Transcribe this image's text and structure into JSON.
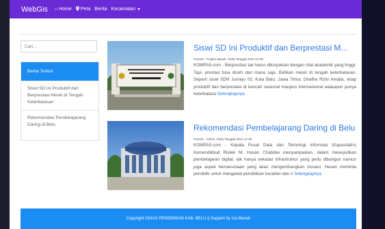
{
  "navbar": {
    "brand": "WebGis",
    "items": [
      {
        "icon": "home-icon",
        "label": "Home"
      },
      {
        "icon": "map-pin-icon",
        "label": "Peta"
      },
      {
        "label": "Berita"
      },
      {
        "label": "Kecamatan",
        "dropdown": true
      }
    ]
  },
  "search": {
    "placeholder": "Cari..."
  },
  "sidebar": {
    "heading": "Berita Terkini",
    "items": [
      {
        "label": "Siswi SD Ini Produktif dan Berprestasi Meski di Tengah Keterbatasan"
      },
      {
        "label": "Rekomendasi Pembelajarang Daring di Belu"
      }
    ]
  },
  "posts": [
    {
      "title": "Siswi SD Ini Produktif dan Berprestasi M...",
      "meta": "Penulis : Fingilia Manek, Pada Tanggal 2021-12-06",
      "body": "KOMPAS.com - Berprestasi tak harus ditunjukkan dengan nilai akademik yang tinggi. Tapi, prestasi bisa diraih dari mana saja. Bahkan meski di tengah keterbatasan. Seperti siswi SDN Junrejo 02, Kota Batu, Jawa Timur, Dhafira Rizki Amalia, tetap produktif dan berprestasi di kancah nasional maupun internasional walaupun punya keterbatasa",
      "more": "Selengkapnya",
      "image_sign_text": "PEMERINTAH KABUPATEN BELU / SD NEGERI ... / ... ATAMBUA"
    },
    {
      "title": "Rekomendasi Pembelajarang Daring di Belu",
      "meta": "Penulis : Admin, Pada Tanggal 2021-12-06",
      "body": "KOMPAS.com - Kepala Pusat Data dan Teknologi Informasi (Kapusdatin) Kemendikbud Ristek M. Hasan Chabibie menyampaikan, dalam mewujudkan pembelajaran digital, tak hanya sekadar infrastruktur yang perlu dibangun namun juga aspek kemanusiaan yang akan mengembangkan inovasi. Hasan meminta pendidik untuk mengawal pendidikan karakter dan n",
      "more": "Selengkapnya"
    }
  ],
  "footer": {
    "text": "Copyright DINAS PENDIDIKAN KAB. BELU || Support by Lia Manek"
  },
  "colors": {
    "navbar": "#6a2ad6",
    "accent": "#1a8cf2",
    "link": "#2878ea"
  }
}
